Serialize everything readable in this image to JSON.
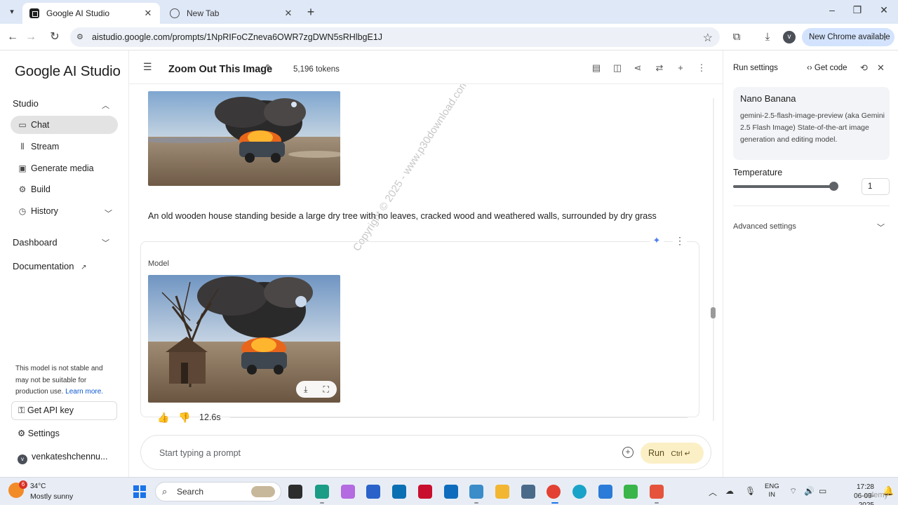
{
  "browser": {
    "tabs": [
      {
        "title": "Google AI Studio",
        "active": true
      },
      {
        "title": "New Tab",
        "active": false
      }
    ],
    "url": "aistudio.google.com/prompts/1NpRIFoCZneva6OWR7zgDWN5sRHlbgE1J",
    "profile_initial": "v",
    "update_label": "New Chrome available"
  },
  "sidebar": {
    "logo": "Google AI Studio",
    "studio_label": "Studio",
    "items": [
      {
        "label": "Chat",
        "icon": "chat-icon"
      },
      {
        "label": "Stream",
        "icon": "stream-icon"
      },
      {
        "label": "Generate media",
        "icon": "media-icon"
      },
      {
        "label": "Build",
        "icon": "build-icon"
      },
      {
        "label": "History",
        "icon": "history-icon"
      }
    ],
    "dashboard_label": "Dashboard",
    "documentation_label": "Documentation",
    "warning_text": "This model is not stable and may not be suitable for production use.",
    "learn_more": "Learn more.",
    "api_key_label": "Get API key",
    "settings_label": "Settings",
    "user_name": "venkateshchennu...",
    "user_initial": "v"
  },
  "header": {
    "title": "Zoom Out This Image",
    "tokens": "5,196 tokens"
  },
  "chat": {
    "user_prompt": "An old wooden house standing beside a large dry tree with no leaves, cracked wood and weathered walls, surrounded by dry grass",
    "model_label": "Model",
    "response_time": "12.6s",
    "watermark": "Copyright © 2025 - www.p30download.com",
    "prompt_placeholder": "Start typing a prompt",
    "run_label": "Run",
    "run_shortcut": "Ctrl ↵"
  },
  "run_settings": {
    "title": "Run settings",
    "get_code": "Get code",
    "model_name": "Nano Banana",
    "model_desc": "gemini-2.5-flash-image-preview (aka Gemini 2.5 Flash Image) State-of-the-art image generation and editing model.",
    "temperature_label": "Temperature",
    "temperature_value": "1",
    "temperature_fraction": 1.0,
    "advanced_label": "Advanced settings"
  },
  "taskbar": {
    "weather_temp": "34°C",
    "weather_cond": "Mostly sunny",
    "weather_badge": "6",
    "search_label": "Search",
    "lang_line1": "ENG",
    "lang_line2": "IN",
    "time": "17:28",
    "date": "06-09-2025",
    "brand": "udemy"
  }
}
